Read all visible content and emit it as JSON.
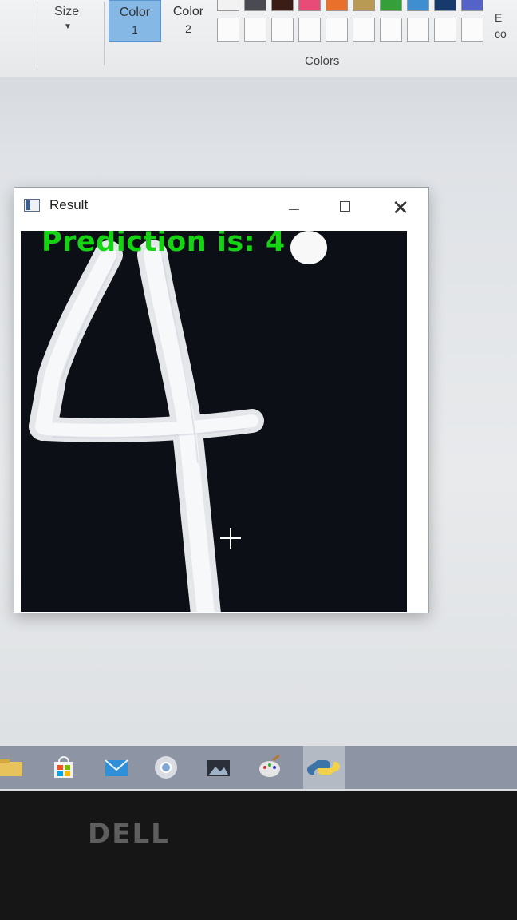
{
  "paint_ribbon": {
    "size_label": "Size",
    "color1_label": "Color",
    "color1_num": "1",
    "color2_label": "Color",
    "color2_num": "2",
    "colors_group_label": "Colors",
    "edit_colors_label_line1": "E",
    "edit_colors_label_line2": "co",
    "palette_colors": [
      "#f2f2f2",
      "#4a4a52",
      "#3b1d16",
      "#e84b78",
      "#e8702a",
      "#b89a55",
      "#35a03a",
      "#3f8fd0",
      "#163a6b",
      "#5563c8"
    ],
    "accent_color": "#86b8e6"
  },
  "result_window": {
    "title": "Result",
    "prediction_text": "Prediction is: 4",
    "prediction_color": "#14d414",
    "canvas_background": "#0d0f16",
    "drawn_digit": "4"
  },
  "taskbar": {
    "apps": [
      "file-explorer-icon",
      "store-icon",
      "mail-icon",
      "chrome-icon",
      "photos-icon",
      "paint-icon",
      "python-icon"
    ]
  },
  "bezel": {
    "brand": "DELL"
  }
}
